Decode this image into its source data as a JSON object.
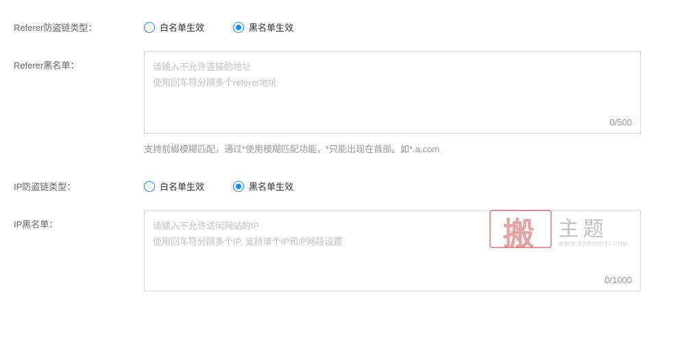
{
  "referer_type": {
    "label": "Referer防盗链类型：",
    "whitelist_label": "白名单生效",
    "blacklist_label": "黑名单生效",
    "selected": "blacklist"
  },
  "referer_blacklist": {
    "label": "Referer黑名单：",
    "placeholder_line1": "请输入不允许连接的地址",
    "placeholder_line2": "使用回车符分隔多个referer地址",
    "counter": "0/500",
    "help": "支持前缀模糊匹配，通过*使用模糊匹配功能，*只能出现在首部。如*.a.com"
  },
  "ip_type": {
    "label": "IP防盗链类型：",
    "whitelist_label": "白名单生效",
    "blacklist_label": "黑名单生效",
    "selected": "blacklist"
  },
  "ip_blacklist": {
    "label": "IP黑名单：",
    "placeholder_line1": "请输入不允许访问网站的IP",
    "placeholder_line2": "使用回车符分隔多个IP, 支持单个IP和IP网段设置",
    "counter": "0/1000"
  },
  "watermark": {
    "stamp_char": "搬",
    "title": "主题",
    "url": "WWW.BANZHUTI.COM"
  }
}
